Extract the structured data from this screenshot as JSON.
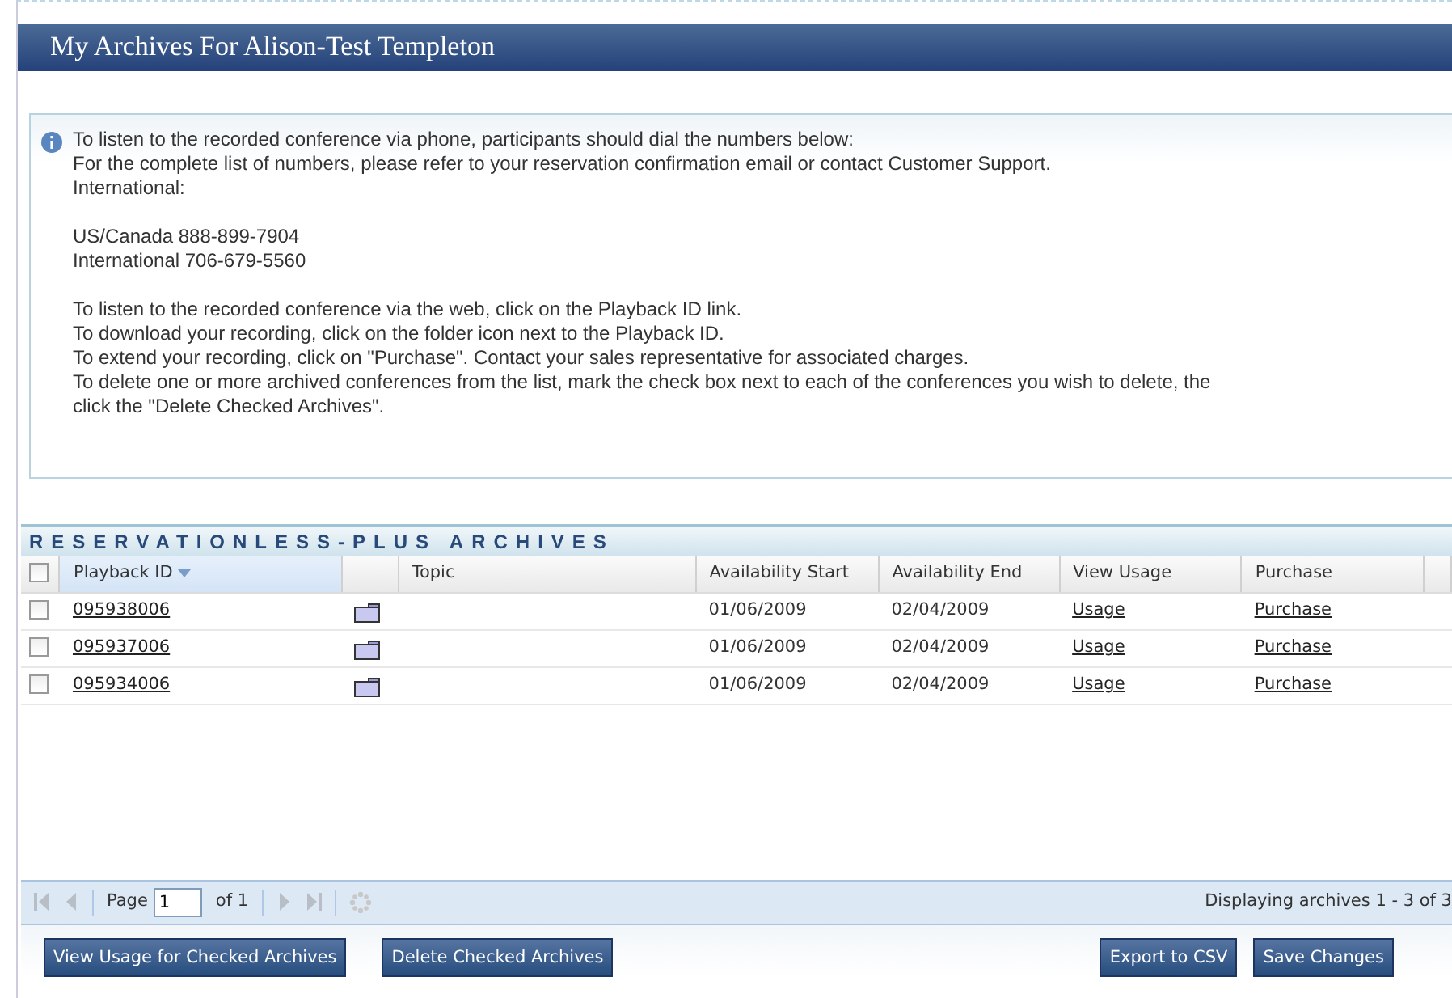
{
  "title": "My Archives For Alison-Test Templeton",
  "info": {
    "groups": [
      [
        "To listen to the recorded conference via phone, participants should dial the numbers below:",
        "For the complete list of numbers, please refer to your reservation confirmation email or contact Customer Support.",
        "International:"
      ],
      [
        "US/Canada 888-899-7904",
        "International  706-679-5560"
      ],
      [
        "To listen to the recorded conference via the web, click on the Playback ID link.",
        "To download your recording, click on the folder icon next to the Playback ID.",
        "To extend your recording, click on \"Purchase\". Contact your sales representative for associated charges.",
        "To delete one or more archived conferences from the list, mark the check box next to each of the conferences you wish to delete, the",
        "click the \"Delete Checked Archives\"."
      ]
    ]
  },
  "section_title": "RESERVATIONLESS-PLUS ARCHIVES",
  "table": {
    "all_checked": false,
    "columns": [
      {
        "label": "Playback ID",
        "sorted": true
      },
      {},
      {
        "label": "Topic",
        "sorted": false
      },
      {
        "label": "Availability Start",
        "sorted": false
      },
      {
        "label": "Availability End",
        "sorted": false
      },
      {
        "label": "View Usage",
        "sorted": false
      },
      {
        "label": "Purchase",
        "sorted": false
      }
    ],
    "rows": [
      {
        "checked": false,
        "id": "095938006",
        "start": "01/06/2009",
        "end": "02/04/2009",
        "usage": "Usage",
        "purchase": "Purchase"
      },
      {
        "checked": false,
        "id": "095937006",
        "start": "01/06/2009",
        "end": "02/04/2009",
        "usage": "Usage",
        "purchase": "Purchase"
      },
      {
        "checked": false,
        "id": "095934006",
        "start": "01/06/2009",
        "end": "02/04/2009",
        "usage": "Usage",
        "purchase": "Purchase"
      }
    ]
  },
  "pager": {
    "page_label": "Page",
    "page": "1",
    "of": "of 1",
    "display": "Displaying archives 1 - 3 of 3"
  },
  "buttons_left": [
    "View Usage for Checked Archives",
    "Delete Checked Archives"
  ],
  "buttons_right": [
    "Export to CSV",
    "Save Changes"
  ]
}
